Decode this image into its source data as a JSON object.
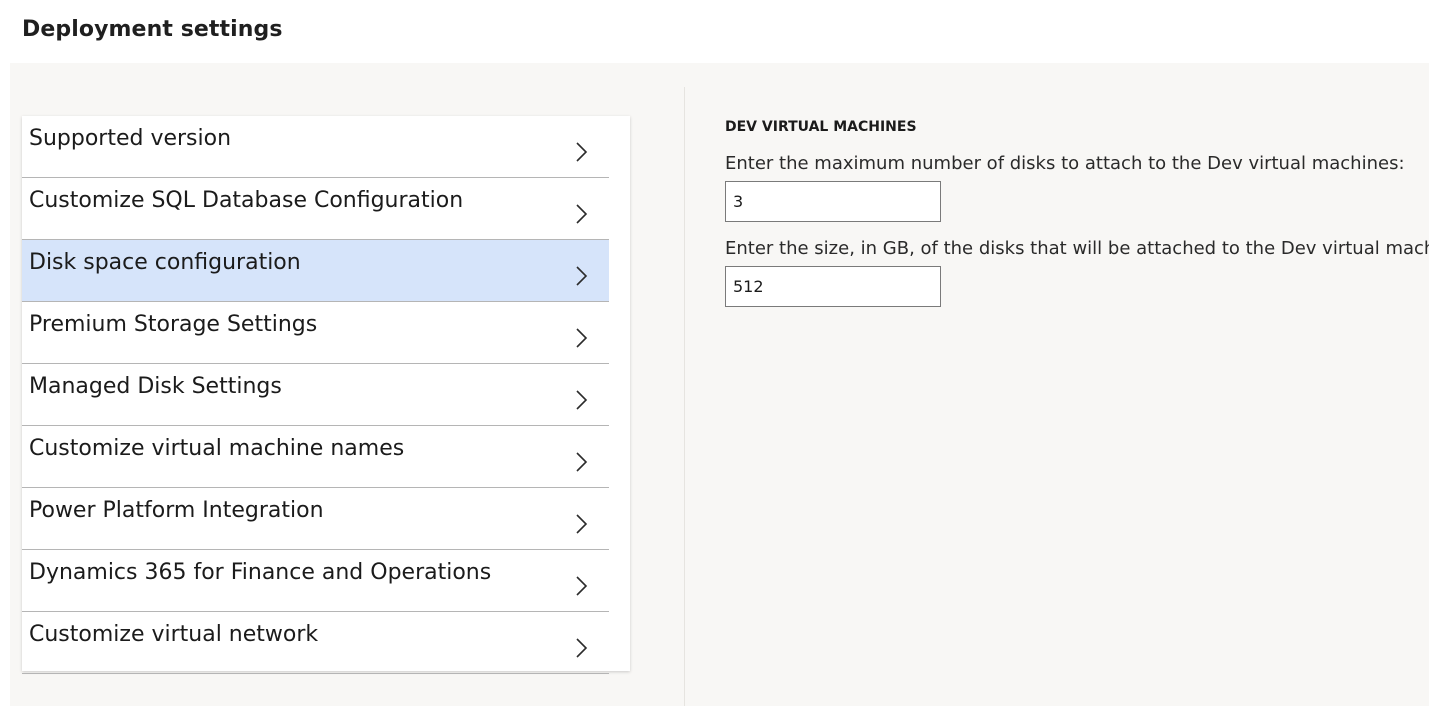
{
  "header": {
    "title": "Deployment settings"
  },
  "nav": {
    "items": [
      {
        "label": "Supported version",
        "icon": "chevron-right-icon",
        "selected": false
      },
      {
        "label": "Customize SQL Database Configuration",
        "icon": "chevron-right-icon",
        "selected": false
      },
      {
        "label": "Disk space configuration",
        "icon": "chevron-right-icon",
        "selected": true
      },
      {
        "label": "Premium Storage Settings",
        "icon": "chevron-right-icon",
        "selected": false
      },
      {
        "label": "Managed Disk Settings",
        "icon": "chevron-right-icon",
        "selected": false
      },
      {
        "label": "Customize virtual machine names",
        "icon": "chevron-right-icon",
        "selected": false
      },
      {
        "label": "Power Platform Integration",
        "icon": "chevron-right-icon",
        "selected": false
      },
      {
        "label": "Dynamics 365 for Finance and Operations",
        "icon": "chevron-right-icon",
        "selected": false
      },
      {
        "label": "Customize virtual network",
        "icon": "chevron-right-icon",
        "selected": false
      }
    ]
  },
  "detail": {
    "section_title": "DEV VIRTUAL MACHINES",
    "max_disks": {
      "label": "Enter the maximum number of disks to attach to the Dev virtual machines:",
      "value": "3"
    },
    "disk_size": {
      "label": "Enter the size, in GB, of the disks that will be attached to the Dev virtual machines:",
      "value": "512"
    }
  },
  "colors": {
    "selected_row": "#d6e4fa",
    "panel_background": "#f8f7f5",
    "row_divider": "#b5b5b5"
  }
}
